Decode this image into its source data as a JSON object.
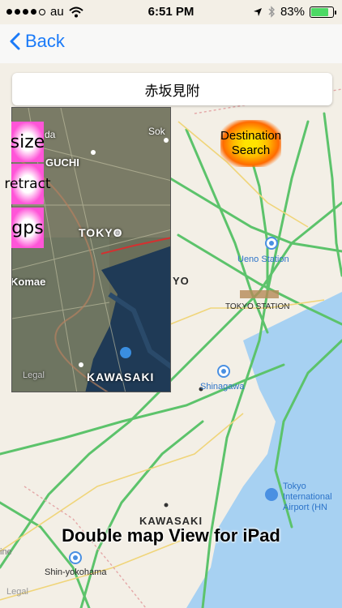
{
  "status": {
    "carrier": "au",
    "time": "6:51 PM",
    "battery": "83%"
  },
  "nav": {
    "back_label": "Back"
  },
  "title": "赤坂見附",
  "mini_map": {
    "labels": {
      "tokyo": "TOKYO",
      "guchi": "GUCHI",
      "komae": "Komae",
      "kawasaki": "KAWASAKI",
      "soka": "Sok",
      "da": "da",
      "legal": "Legal"
    }
  },
  "buttons": {
    "size": "size",
    "retract": "retract",
    "gps": "gps"
  },
  "destination": {
    "line1": "Destination",
    "line2": "Search"
  },
  "map_labels": {
    "ueno": "Ueno Station",
    "tokyo_station": "TOKYO STATION",
    "yo": "YO",
    "shinagawa": "Shinagawa",
    "tokyo_intl": "Tokyo International Airport (HN",
    "kawasaki": "KAWASAKI",
    "shin_yokohama": "Shin-yokohama",
    "legal": "Legal",
    "ine": "ine"
  },
  "caption": "Double map View for iPad",
  "colors": {
    "accent": "#1a7af8",
    "highway": "#5cc36b",
    "water": "#a7d1f2"
  }
}
